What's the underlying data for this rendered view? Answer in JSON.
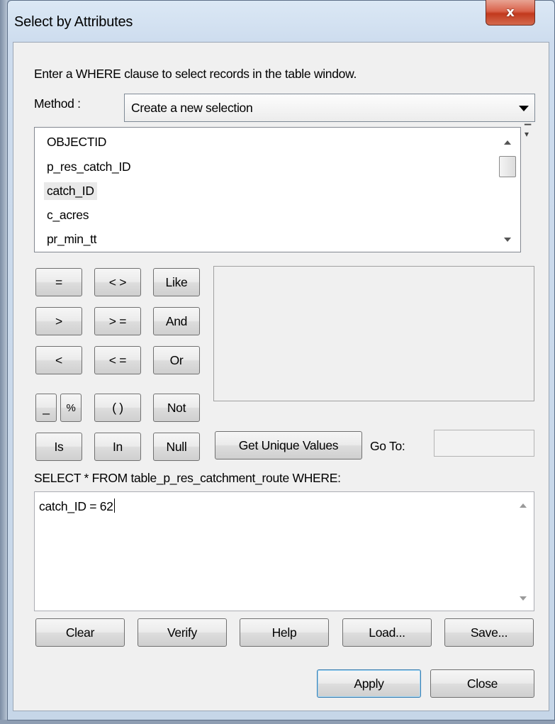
{
  "window": {
    "title": "Select by Attributes",
    "close_glyph": "x"
  },
  "instruction": "Enter a WHERE clause to select records in the table window.",
  "method": {
    "label": "Method :",
    "value": "Create a new selection"
  },
  "fields": {
    "items": [
      "OBJECTID",
      "p_res_catch_ID",
      "catch_ID",
      "c_acres",
      "pr_min_tt"
    ],
    "selected": "catch_ID"
  },
  "operators": {
    "eq": "=",
    "neq": "< >",
    "like": "Like",
    "gt": ">",
    "gte": "> =",
    "and": "And",
    "lt": "<",
    "lte": "< =",
    "or": "Or",
    "underscore": "_",
    "percent": "%",
    "parens": "( )",
    "not": "Not",
    "is": "Is",
    "in": "In",
    "null": "Null"
  },
  "get_unique_values": "Get Unique Values",
  "goto": {
    "label": "Go To:",
    "value": ""
  },
  "select_statement": "SELECT * FROM table_p_res_catchment_route WHERE:",
  "expression": "catch_ID = 62",
  "buttons": {
    "clear": "Clear",
    "verify": "Verify",
    "help": "Help",
    "load": "Load...",
    "save": "Save...",
    "apply": "Apply",
    "close": "Close"
  }
}
